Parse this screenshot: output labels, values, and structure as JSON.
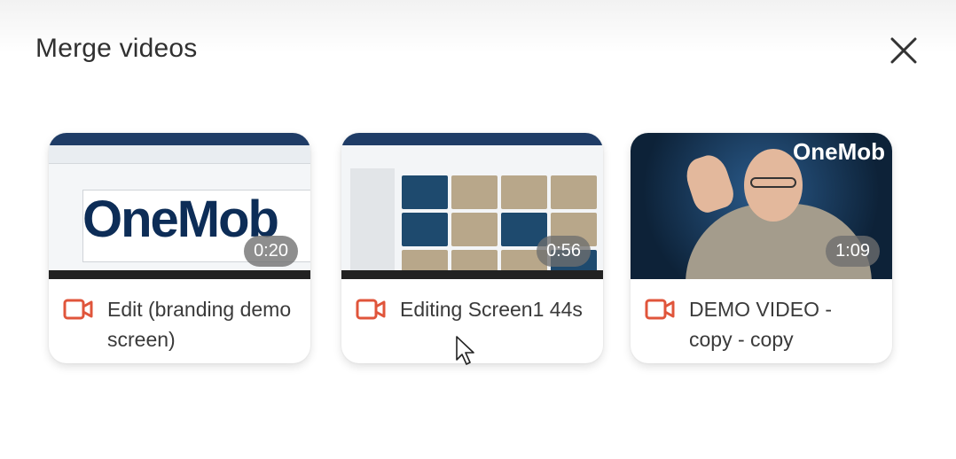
{
  "header": {
    "title": "Merge videos",
    "close_icon": "close-icon"
  },
  "videos": [
    {
      "title": "Edit (branding demo screen)",
      "duration": "0:20",
      "thumbnail_text": "OneMob",
      "icon": "video-camera-icon"
    },
    {
      "title": "Editing Screen1 44s",
      "duration": "0:56",
      "icon": "video-camera-icon"
    },
    {
      "title": "DEMO VIDEO - copy - copy",
      "duration": "1:09",
      "thumbnail_text": "OneMob",
      "icon": "video-camera-icon"
    }
  ],
  "colors": {
    "accent": "#e0553b",
    "badge": "#6e6e6e"
  }
}
